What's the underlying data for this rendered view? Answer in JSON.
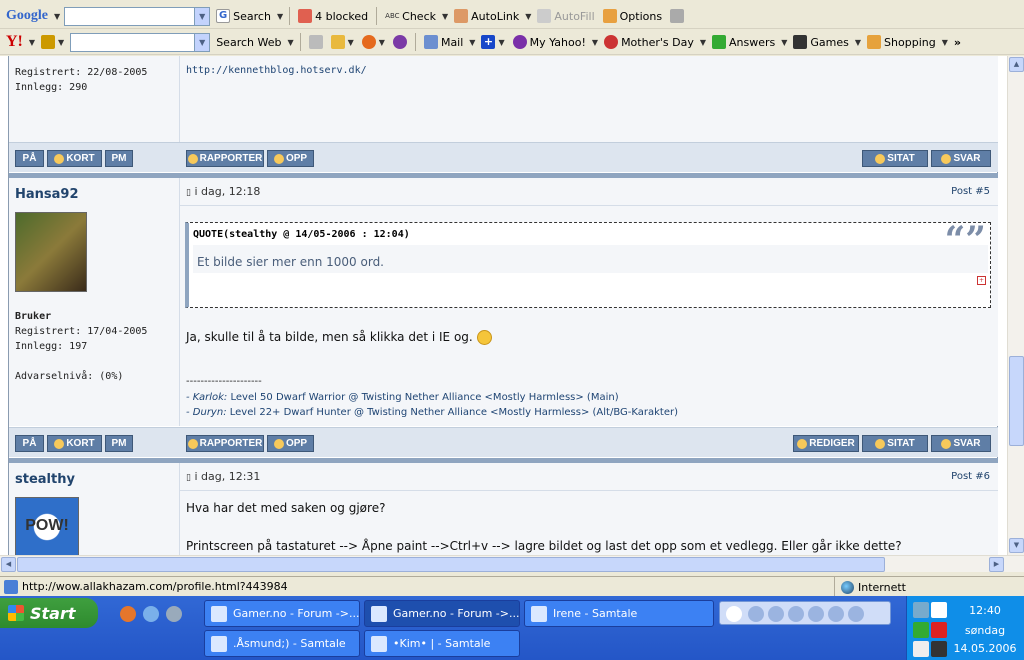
{
  "toolbar1": {
    "brand": "Google",
    "search": "Search",
    "blocked": "4 blocked",
    "check": "Check",
    "autolink": "AutoLink",
    "autofill": "AutoFill",
    "options": "Options"
  },
  "toolbar2": {
    "brand": "Y!",
    "search_web": "Search Web",
    "mail": "Mail",
    "myyahoo": "My Yahoo!",
    "mothers_day": "Mother's Day",
    "answers": "Answers",
    "games": "Games",
    "shopping": "Shopping"
  },
  "post0": {
    "registered": "Registrert: 22/08-2005",
    "posts": "Innlegg: 290",
    "link": "http://kennethblog.hotserv.dk/"
  },
  "buttons": {
    "pa": "PÅ",
    "kort": "KORT",
    "pm": "PM",
    "rapporter": "RAPPORTER",
    "opp": "OPP",
    "sitat": "SITAT",
    "svar": "SVAR",
    "rediger": "REDIGER"
  },
  "post5": {
    "user": "Hansa92",
    "time": "i dag, 12:18",
    "num": "Post #5",
    "rank": "Bruker",
    "registered": "Registrert: 17/04-2005",
    "posts": "Innlegg: 197",
    "warn": "Advarselnivå: (0%)",
    "quote_head": "QUOTE(stealthy @ 14/05-2006 : 12:04)",
    "quote_text": "Et bilde sier mer enn 1000 ord.",
    "text": "Ja, skulle til å ta bilde, men så klikka det i IE og.",
    "sep": "---------------------",
    "sig1_name": "- Karlok:",
    "sig1": "Level 50 Dwarf Warrior @ Twisting Nether Alliance <Mostly Harmless> (Main)",
    "sig2_name": "- Duryn:",
    "sig2": "Level 22+ Dwarf Hunter @ Twisting Nether Alliance <Mostly Harmless> (Alt/BG-Karakter)"
  },
  "post6": {
    "user": "stealthy",
    "time": "i dag, 12:31",
    "num": "Post #6",
    "text1": "Hva har det med saken og gjøre?",
    "text2": "Printscreen på tastaturet --> Åpne paint -->Ctrl+v --> lagre bildet og last det opp som et vedlegg. Eller går ikke dette?",
    "avatar_text": "POW!"
  },
  "status": {
    "url": "http://wow.allakhazam.com/profile.html?443984",
    "zone": "Internett"
  },
  "taskbar": {
    "start": "Start",
    "tasks": [
      "Gamer.no - Forum ->...",
      "Gamer.no - Forum ->...",
      "Irene - Samtale",
      ".Åsmund;) - Samtale",
      "•Kim• | - Samtale"
    ],
    "time": "12:40",
    "day": "søndag",
    "date": "14.05.2006"
  }
}
